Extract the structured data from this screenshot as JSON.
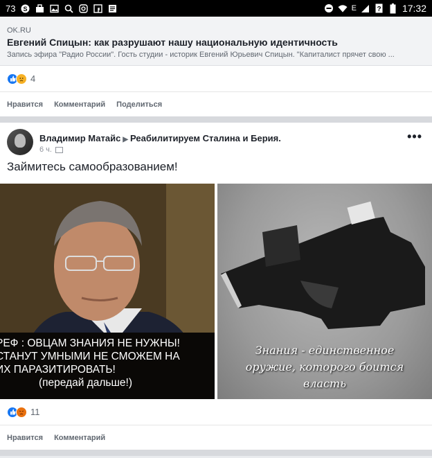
{
  "status_bar": {
    "left_text": "73",
    "time": "17:32",
    "network": "E"
  },
  "shared_post": {
    "link_preview": {
      "domain": "OK.RU",
      "title": "Евгений Спицын: как разрушают нашу национальную идентичность",
      "description": "Запись эфира \"Радио России\". Гость студии - историк Евгений Юрьевич Спицын. \"Капиталист прячет свою ..."
    },
    "reaction_count": "4",
    "actions": [
      "Нравится",
      "Комментарий",
      "Поделиться"
    ]
  },
  "post": {
    "author": "Владимир Матайс",
    "group": "Реабилитируем Сталина и Берия.",
    "time": "6 ч.",
    "text": "Займитесь самообразованием!",
    "photo1_caption": [
      "РЕФ : ОВЦАМ ЗНАНИЯ НЕ НУЖНЫ!",
      "СТАНУТ УМНЫМИ НЕ СМОЖЕМ НА",
      "ИХ ПАРАЗИТИРОВАТЬ!",
      "(передай дальше!)"
    ],
    "photo2_caption": [
      "Знания - единственное",
      "оружие, которого боится",
      "власть"
    ],
    "reaction_count": "11",
    "actions": [
      "Нравится",
      "Комментарий"
    ]
  },
  "colors": {
    "like_blue": "#1877f2",
    "text_dark": "#1d2129",
    "text_gray": "#606770"
  }
}
